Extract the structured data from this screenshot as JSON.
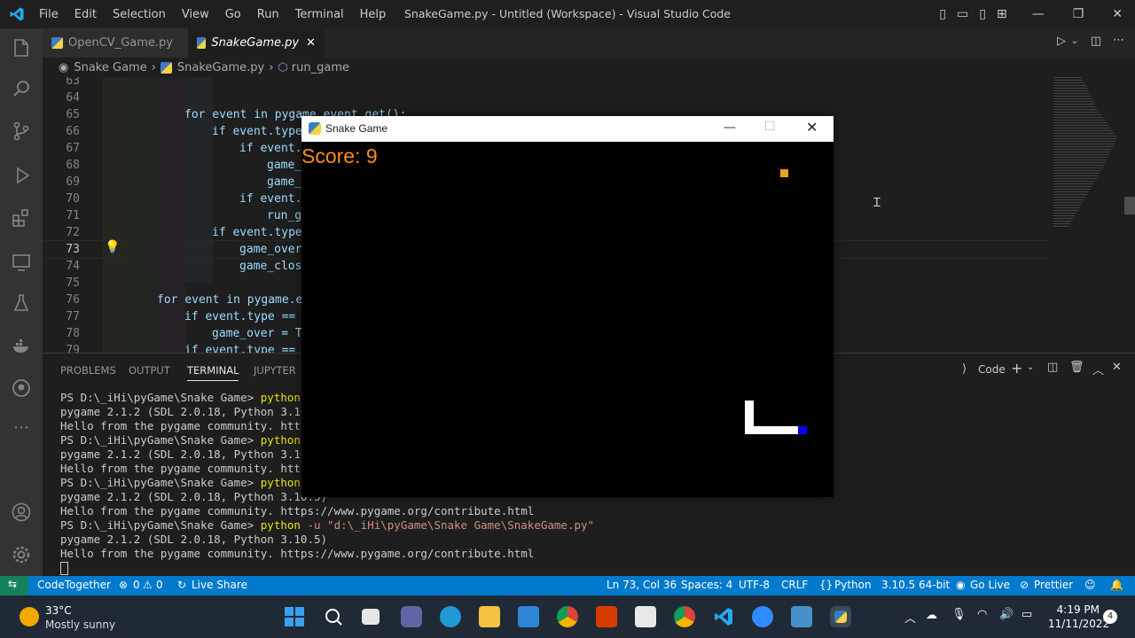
{
  "window": {
    "title": "SnakeGame.py - Untitled (Workspace) - Visual Studio Code",
    "menu": [
      "File",
      "Edit",
      "Selection",
      "View",
      "Go",
      "Run",
      "Terminal",
      "Help"
    ]
  },
  "tabs": [
    {
      "label": "OpenCV_Game.py",
      "active": false
    },
    {
      "label": "SnakeGame.py",
      "active": true,
      "close": "✕"
    }
  ],
  "breadcrumb": [
    "Snake Game",
    "SnakeGame.py",
    "run_game"
  ],
  "editor": {
    "lines": [
      {
        "n": "63",
        "t": ""
      },
      {
        "n": "64",
        "t": ""
      },
      {
        "n": "65",
        "t": "for event in pygame.event.get():"
      },
      {
        "n": "66",
        "t": "if event.type"
      },
      {
        "n": "67",
        "t": "if event."
      },
      {
        "n": "68",
        "t": "game_"
      },
      {
        "n": "69",
        "t": "game_"
      },
      {
        "n": "70",
        "t": "if event."
      },
      {
        "n": "71",
        "t": "run_g"
      },
      {
        "n": "72",
        "t": "if event.type"
      },
      {
        "n": "73",
        "t": "game_over"
      },
      {
        "n": "74",
        "t": "game_clos"
      },
      {
        "n": "75",
        "t": ""
      },
      {
        "n": "76",
        "t": "for event in pygame.e"
      },
      {
        "n": "77",
        "t": "if event.type =="
      },
      {
        "n": "78",
        "t": "game_over = T"
      },
      {
        "n": "79",
        "t": "if event.type =="
      }
    ]
  },
  "panel": {
    "tabs": [
      "PROBLEMS",
      "OUTPUT",
      "TERMINAL",
      "JUPYTER"
    ],
    "active_tab": "TERMINAL",
    "shell_label": "Code",
    "terminal": [
      {
        "p": "PS D:\\_iHi\\pyGame\\Snake Game> ",
        "c": "python",
        "r": ""
      },
      {
        "p": "pygame 2.1.2 (SDL 2.0.18, Python 3.10",
        "c": "",
        "r": ""
      },
      {
        "p": "Hello from the pygame community. http",
        "c": "",
        "r": ""
      },
      {
        "p": "PS D:\\_iHi\\pyGame\\Snake Game> ",
        "c": "python",
        "r": ""
      },
      {
        "p": "pygame 2.1.2 (SDL 2.0.18, Python 3.10",
        "c": "",
        "r": ""
      },
      {
        "p": "Hello from the pygame community. http",
        "c": "",
        "r": ""
      },
      {
        "p": "PS D:\\_iHi\\pyGame\\Snake Game> ",
        "c": "python",
        "r": ""
      },
      {
        "p": "pygame 2.1.2 (SDL 2.0.18, Python 3.10.5)",
        "c": "",
        "r": ""
      },
      {
        "p": "Hello from the pygame community. https://www.pygame.org/contribute.html",
        "c": "",
        "r": ""
      },
      {
        "p": "PS D:\\_iHi\\pyGame\\Snake Game> ",
        "c": "python",
        "r": " -u \"d:\\_iHi\\pyGame\\Snake Game\\SnakeGame.py\""
      },
      {
        "p": "pygame 2.1.2 (SDL 2.0.18, Python 3.10.5)",
        "c": "",
        "r": ""
      },
      {
        "p": "Hello from the pygame community. https://www.pygame.org/contribute.html",
        "c": "",
        "r": ""
      }
    ]
  },
  "status": {
    "codetogether": "CodeTogether",
    "errors": "0",
    "warnings": "0",
    "liveshare": "Live Share",
    "position": "Ln 73, Col 36",
    "spaces": "Spaces: 4",
    "encoding": "UTF-8",
    "eol": "CRLF",
    "language": "Python",
    "interpreter": "3.10.5 64-bit",
    "golive": "Go Live",
    "prettier": "Prettier"
  },
  "game": {
    "title": "Snake Game",
    "score_label": "Score: 9",
    "food_color": "#f0a020",
    "snake_color": "#ffffff",
    "head_color": "#0000ff"
  },
  "taskbar": {
    "temperature": "33°C",
    "weather": "Mostly sunny",
    "time": "4:19 PM",
    "date": "11/11/2022",
    "notifications": "4"
  },
  "colors": {
    "accent": "#007acc",
    "score": "#ff8c1a"
  }
}
